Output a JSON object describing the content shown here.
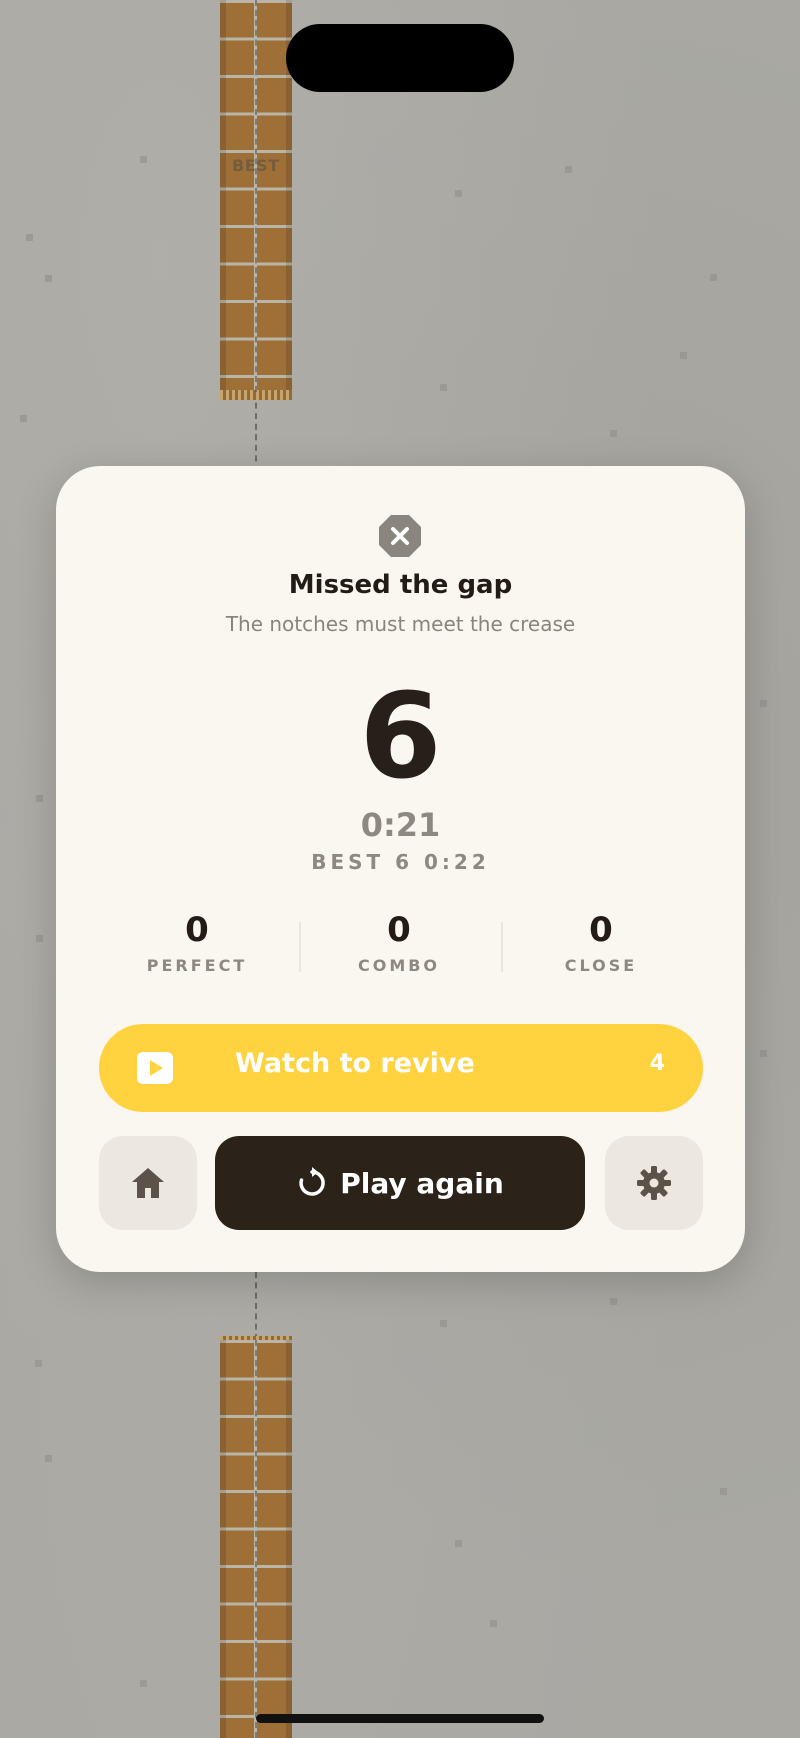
{
  "game": {
    "board_marker": "BEST"
  },
  "result": {
    "title": "Missed the gap",
    "subtitle": "The notches must meet the crease",
    "score": "6",
    "time": "0:21",
    "best": "BEST 6  0:22"
  },
  "stats": [
    {
      "value": "0",
      "label": "PERFECT"
    },
    {
      "value": "0",
      "label": "COMBO"
    },
    {
      "value": "0",
      "label": "CLOSE"
    }
  ],
  "revive": {
    "label": "Watch to revive",
    "count": "4"
  },
  "actions": {
    "home_icon": "home-icon",
    "play_again_label": "Play again",
    "play_again_icon": "refresh-icon",
    "settings_icon": "gear-icon"
  },
  "colors": {
    "revive": "#ffd23f",
    "play_again": "#2b2219",
    "card": "#faf7f0",
    "pillar": "#9e7038"
  }
}
